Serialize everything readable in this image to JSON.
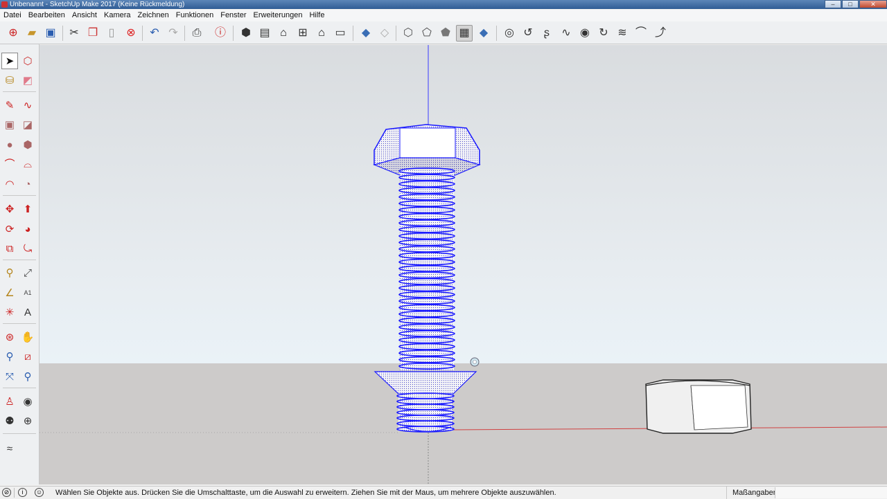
{
  "window": {
    "title": "Unbenannt - SketchUp Make 2017 (Keine Rückmeldung)",
    "buttons": [
      "–",
      "□",
      "✕"
    ]
  },
  "menu": [
    "Datei",
    "Bearbeiten",
    "Ansicht",
    "Kamera",
    "Zeichnen",
    "Funktionen",
    "Fenster",
    "Erweiterungen",
    "Hilfe"
  ],
  "toolbar": {
    "icons": [
      "3d-warehouse-icon",
      "open-icon",
      "save-icon",
      "cut-icon",
      "copy-icon",
      "paste-icon",
      "erase-icon",
      "undo-icon",
      "redo-icon",
      "print-icon",
      "model-info-icon",
      "iso-view-icon",
      "top-view-icon",
      "front-view-icon",
      "right-view-icon",
      "back-view-icon",
      "left-view-icon",
      "xray-icon",
      "back-edges-icon",
      "wireframe-icon",
      "hidden-line-icon",
      "shaded-icon",
      "shaded-textures-icon",
      "monochrome-icon",
      "helix-icon",
      "spiral-icon",
      "curve-icon",
      "bezier-icon",
      "spiral-2-icon",
      "arc-curve-icon",
      "coil-icon",
      "freehand-curve-icon",
      "curve-tool-icon"
    ]
  },
  "left_toolbar": {
    "icons": [
      "select-icon",
      "make-component-icon",
      "paint-bucket-icon",
      "eraser-icon",
      "line-icon",
      "freehand-icon",
      "rectangle-icon",
      "rotated-rectangle-icon",
      "circle-icon",
      "polygon-icon",
      "arc-icon",
      "two-point-arc-icon",
      "three-point-arc-icon",
      "pie-icon",
      "move-icon",
      "push-pull-icon",
      "rotate-icon",
      "follow-me-icon",
      "scale-icon",
      "offset-icon",
      "tape-measure-icon",
      "dimension-icon",
      "protractor-icon",
      "text-icon",
      "axes-icon",
      "3d-text-icon",
      "orbit-icon",
      "pan-icon",
      "zoom-icon",
      "zoom-window-icon",
      "zoom-extents-icon",
      "previous-view-icon",
      "position-camera-icon",
      "look-around-icon",
      "walk-icon",
      "section-plane-icon",
      "sandbox-icon"
    ]
  },
  "statusbar": {
    "message": "Wählen Sie Objekte aus. Drücken Sie die Umschalttaste, um die Auswahl zu erweitern. Ziehen Sie mit der Maus, um mehrere Objekte auszuwählen.",
    "measure_label": "Maßangaben",
    "measure_value": ""
  },
  "colors": {
    "selection": "#1a1aff",
    "sky": "#e4eaee",
    "ground": "#cdcbca",
    "red_axis": "#d04040",
    "blue_axis": "#3a3aff"
  }
}
